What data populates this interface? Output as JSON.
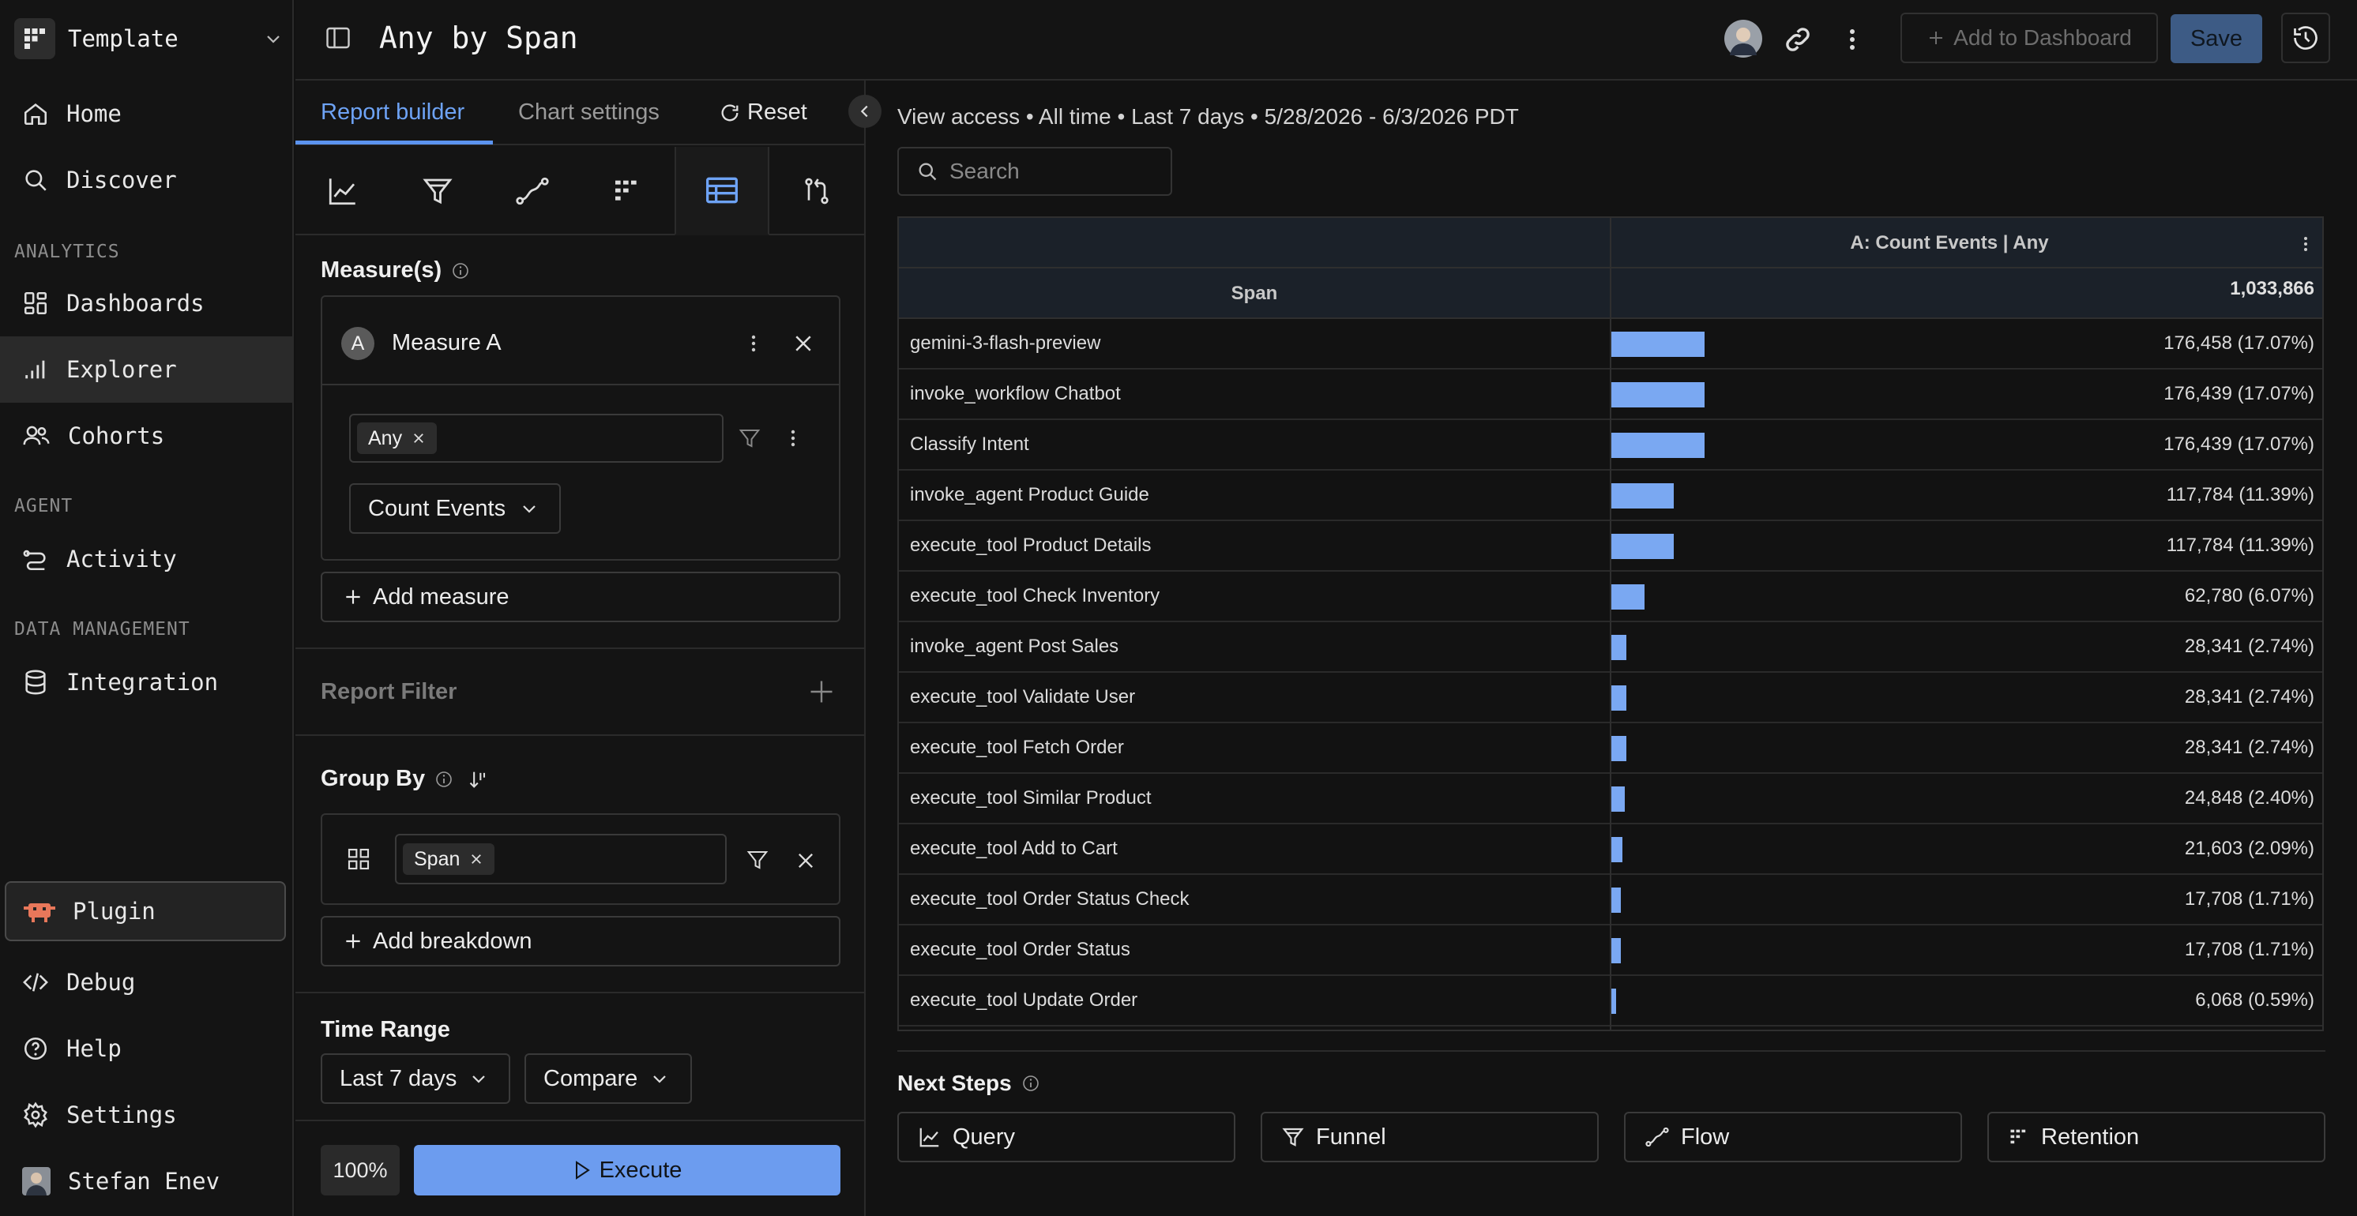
{
  "workspace": {
    "name": "Template"
  },
  "nav": {
    "home": "Home",
    "discover": "Discover",
    "section_analytics": "ANALYTICS",
    "dashboards": "Dashboards",
    "explorer": "Explorer",
    "cohorts": "Cohorts",
    "section_agent": "AGENT",
    "activity": "Activity",
    "section_data": "DATA MANAGEMENT",
    "integration": "Integration",
    "plugin": "Plugin",
    "debug": "Debug",
    "help": "Help",
    "settings": "Settings",
    "user": "Stefan Enev"
  },
  "topbar": {
    "title": "Any by Span",
    "add_to_dashboard": "Add to Dashboard",
    "save": "Save"
  },
  "builder": {
    "tabs": {
      "report_builder": "Report builder",
      "chart_settings": "Chart settings",
      "reset": "Reset"
    },
    "measures_title": "Measure(s)",
    "measure": {
      "badge": "A",
      "name": "Measure A",
      "chip": "Any",
      "aggregation": "Count Events"
    },
    "add_measure": "Add measure",
    "report_filter": "Report Filter",
    "group_by_title": "Group By",
    "group_by_chip": "Span",
    "add_breakdown": "Add breakdown",
    "time_range_title": "Time Range",
    "time_range_value": "Last 7 days",
    "compare": "Compare",
    "zoom": "100%",
    "execute": "Execute"
  },
  "main": {
    "subtitle": "View access • All time • Last 7 days • 5/28/2026 - 6/3/2026 PDT",
    "search_placeholder": "Search",
    "table": {
      "col_measure": "A: Count Events | Any",
      "col_span": "Span",
      "total": "1,033,866",
      "rows": [
        {
          "name": "gemini-3-flash-preview",
          "value": "176,458 (17.07%)",
          "pct": 17.07
        },
        {
          "name": "invoke_workflow Chatbot",
          "value": "176,439 (17.07%)",
          "pct": 17.07
        },
        {
          "name": "Classify Intent",
          "value": "176,439 (17.07%)",
          "pct": 17.07
        },
        {
          "name": "invoke_agent Product Guide",
          "value": "117,784 (11.39%)",
          "pct": 11.39
        },
        {
          "name": "execute_tool Product Details",
          "value": "117,784 (11.39%)",
          "pct": 11.39
        },
        {
          "name": "execute_tool Check Inventory",
          "value": "62,780 (6.07%)",
          "pct": 6.07
        },
        {
          "name": "invoke_agent Post Sales",
          "value": "28,341 (2.74%)",
          "pct": 2.74
        },
        {
          "name": "execute_tool Validate User",
          "value": "28,341 (2.74%)",
          "pct": 2.74
        },
        {
          "name": "execute_tool Fetch Order",
          "value": "28,341 (2.74%)",
          "pct": 2.74
        },
        {
          "name": "execute_tool Similar Product",
          "value": "24,848 (2.40%)",
          "pct": 2.4
        },
        {
          "name": "execute_tool Add to Cart",
          "value": "21,603 (2.09%)",
          "pct": 2.09
        },
        {
          "name": "execute_tool Order Status Check",
          "value": "17,708 (1.71%)",
          "pct": 1.71
        },
        {
          "name": "execute_tool Order Status",
          "value": "17,708 (1.71%)",
          "pct": 1.71
        },
        {
          "name": "execute_tool Update Order",
          "value": "6,068 (0.59%)",
          "pct": 0.59
        }
      ]
    },
    "next_steps": {
      "title": "Next Steps",
      "query": "Query",
      "funnel": "Funnel",
      "flow": "Flow",
      "retention": "Retention"
    }
  },
  "colors": {
    "accent": "#5b93ef",
    "bar": "#7aa8f2",
    "plugin": "#e8775a"
  }
}
